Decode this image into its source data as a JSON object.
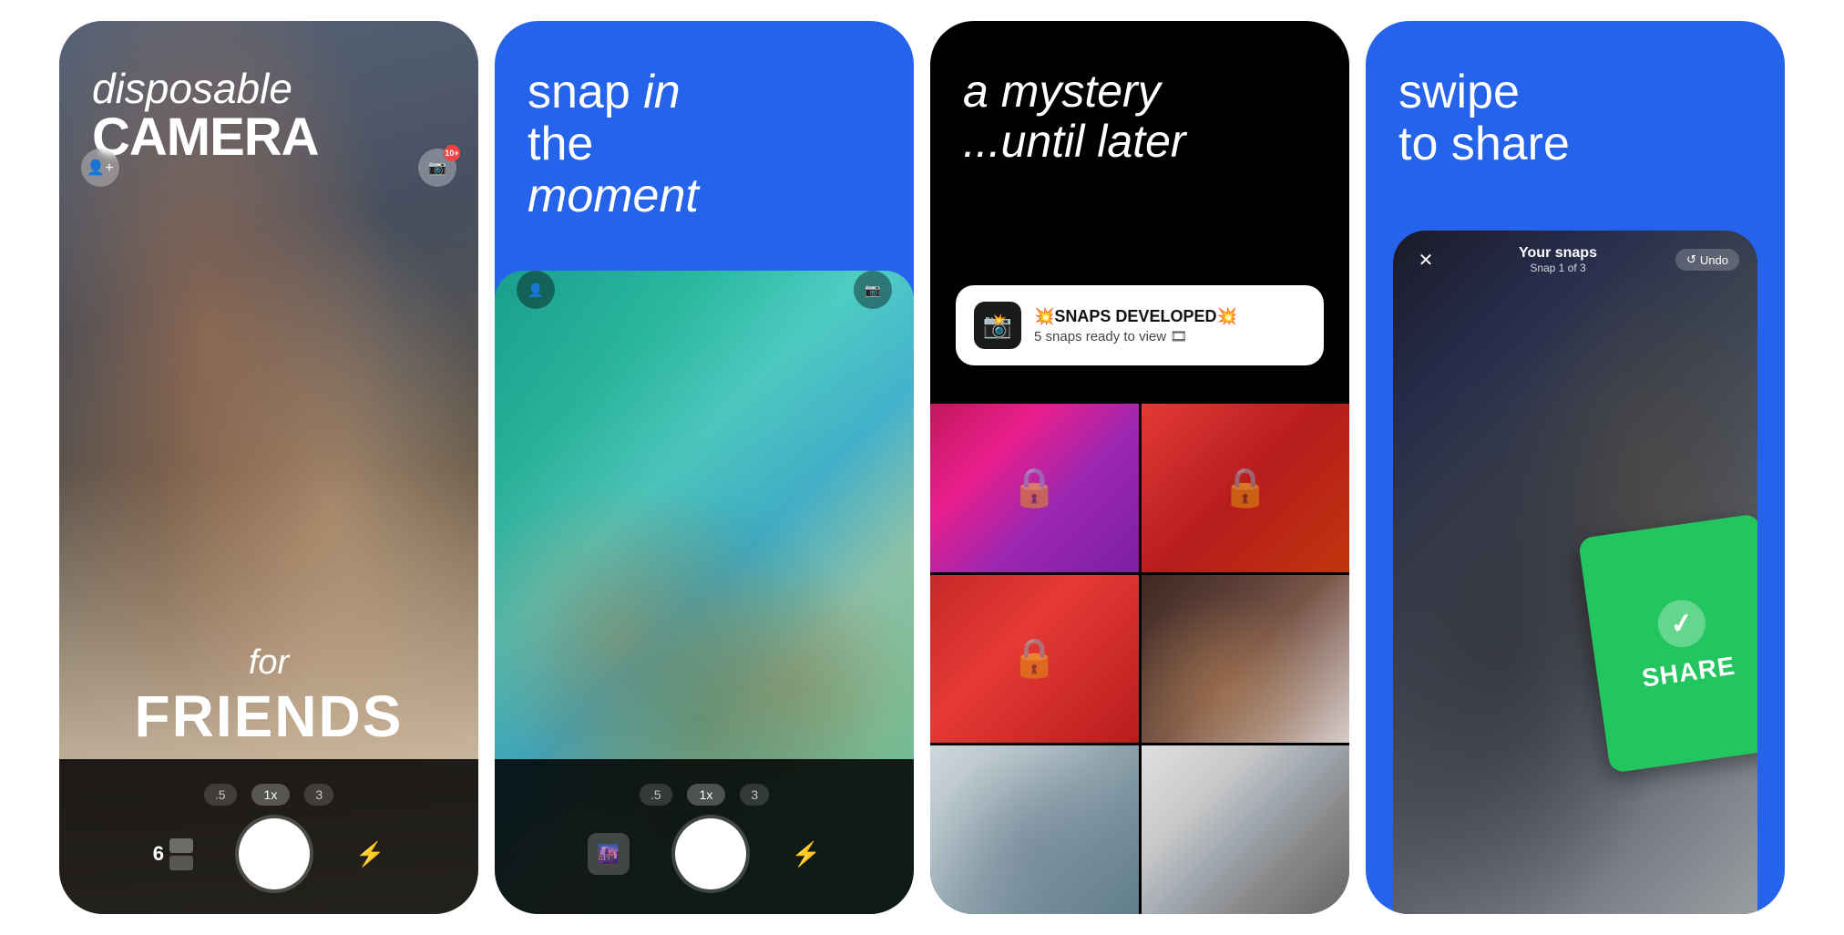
{
  "cards": [
    {
      "id": "card1",
      "background": "photo",
      "headline_line1": "disposable",
      "headline_line2": "CAMERA",
      "overlay_line1": "for",
      "overlay_line2": "FRIENDS",
      "zoom_options": [
        ".5",
        "1x",
        "3"
      ],
      "active_zoom": "1x",
      "film_count": "6",
      "badge_count": "10+"
    },
    {
      "id": "card2",
      "background": "blue",
      "headline_word1": "snap ",
      "headline_word2": "in",
      "headline_line2_word1": "the ",
      "headline_line2_word2": "moment",
      "zoom_options": [
        ".5",
        "1x",
        "3"
      ],
      "active_zoom": "1x"
    },
    {
      "id": "card3",
      "background": "black",
      "headline_line1": "a mystery",
      "headline_line2": "...until later",
      "notification_icon": "📸",
      "notification_title": "💥SNAPS DEVELOPED💥",
      "notification_subtitle": "5 snaps ready to view 🎞",
      "grid_locked": [
        true,
        true,
        false,
        true,
        false,
        false
      ]
    },
    {
      "id": "card4",
      "background": "blue",
      "headline_word1": "swipe",
      "headline_word2": "to share",
      "ui_close": "✕",
      "ui_title": "Your snaps",
      "ui_subtitle": "Snap 1 of 3",
      "ui_undo": "↺ Undo",
      "share_label": "SHARE"
    }
  ],
  "icons": {
    "person_add": "👤",
    "lock": "🔒",
    "camera_flip": "📷",
    "flash": "⚡",
    "checkmark": "✓",
    "close": "✕",
    "undo": "↺"
  }
}
